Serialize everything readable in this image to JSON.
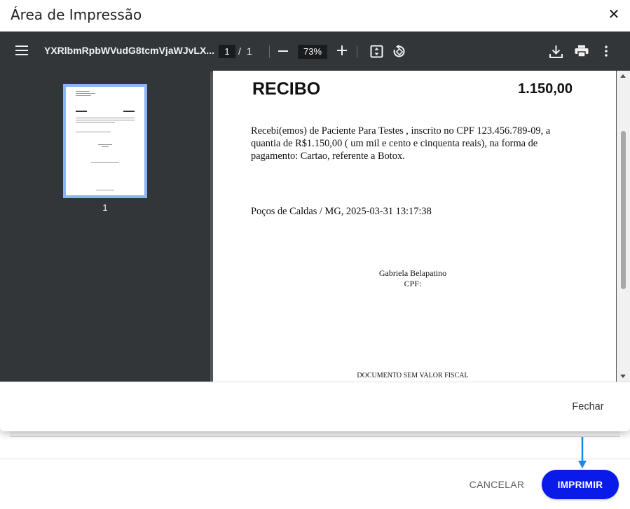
{
  "modal": {
    "title": "Área de Impressão",
    "close_glyph": "✕",
    "footer_close_label": "Fechar"
  },
  "viewer": {
    "filename": "YXRlbmRpbWVudG8tcmVjaWJvLX...",
    "current_page": "1",
    "page_separator": "/",
    "total_pages": "1",
    "zoom": "73%",
    "icons": [
      "menu-icon",
      "zoom-out-icon",
      "zoom-in-icon",
      "fit-page-icon",
      "rotate-icon",
      "download-icon",
      "print-icon",
      "more-vert-icon"
    ],
    "thumbnail_label": "1"
  },
  "document": {
    "title": "RECIBO",
    "amount": "1.150,00",
    "body": "Recebi(emos) de Paciente Para Testes , inscrito no CPF 123.456.789-09, a quantia de R$1.150,00 ( um mil e cento e cinquenta reais), na forma de pagamento: Cartao, referente a Botox.",
    "place_date": "Poços de Caldas / MG, 2025-03-31 13:17:38",
    "signer_name": "Gabriela Belapatino",
    "signer_cpf": "CPF:",
    "footer_note": "DOCUMENTO SEM VALOR FISCAL"
  },
  "page": {
    "cancel_label": "CANCELAR",
    "print_label": "IMPRIMIR"
  },
  "colors": {
    "toolbar_bg": "#323639",
    "viewer_bg": "#525659",
    "thumb_border": "#8ab4f8",
    "primary_button": "#0a1ae8",
    "annotation_arrow": "#1e88e5"
  }
}
